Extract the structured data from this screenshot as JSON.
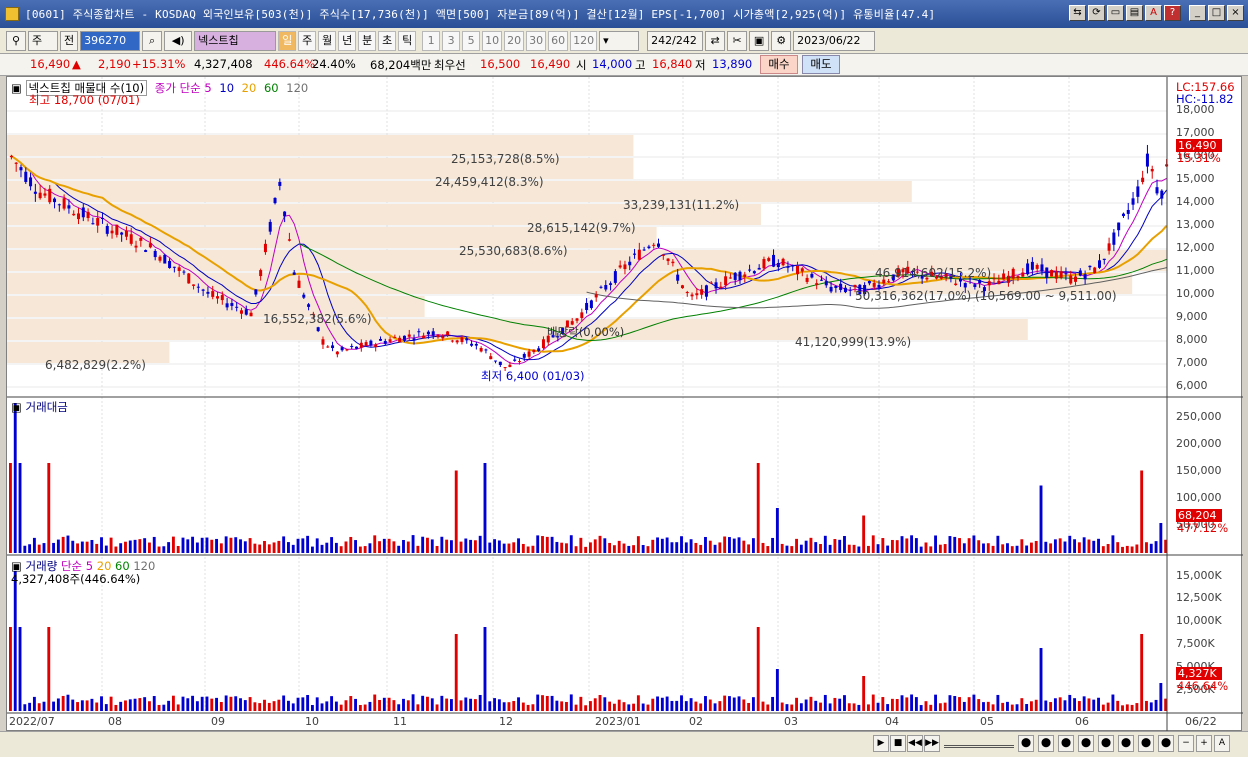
{
  "window": {
    "title": "[0601] 주식종합차트 - KOSDAQ 외국인보유[503(천)] 주식수[17,736(천)] 액면[500] 자본금[89(억)] 결산[12월] EPS[-1,700] 시가총액[2,925(억)] 유통비율[47.4]",
    "buttons": [
      "⇆",
      "⟳",
      "▭",
      "▤",
      "A",
      "?",
      "_",
      "□",
      "×"
    ]
  },
  "toolbar": {
    "mode": "주",
    "prev": "전",
    "code": "396270",
    "name": "넥스트칩",
    "periods": [
      "일",
      "주",
      "월",
      "년",
      "분",
      "초",
      "틱"
    ],
    "intervals": [
      "1",
      "3",
      "5",
      "10",
      "20",
      "30",
      "60",
      "120"
    ],
    "count": "242",
    "count_total": "/242",
    "date": "2023/06/22"
  },
  "quote": {
    "price": "16,490",
    "change_arrow": "▲",
    "change": "2,190",
    "change_pct": "+15.31%",
    "volume": "4,327,408",
    "vol_ratio": "446.64%",
    "turnover": "24.40%",
    "amount": "68,204백만",
    "priority_label": "최우선",
    "ask": "16,500",
    "bid": "16,490",
    "open_label": "시",
    "open": "14,000",
    "high_label": "고",
    "high": "16,840",
    "low_label": "저",
    "low": "13,890",
    "buy": "매수",
    "sell": "매도"
  },
  "price_panel": {
    "legend_stock": "넥스트칩 매물대 수(10)",
    "legend_ma": "종가 단순",
    "ma_periods": [
      "5",
      "10",
      "20",
      "60",
      "120"
    ],
    "high_label": "최고 18,700 (07/01)",
    "low_label": "최저 6,400 (01/03)",
    "dividend_label": "배당락(0,00%)",
    "lc": "LC:157.66",
    "hc": "HC:-11.82",
    "price_tag": "16,490",
    "pct_tag": "15.31%",
    "y_ticks": [
      "18,000",
      "17,000",
      "16,000",
      "15,000",
      "14,000",
      "13,000",
      "12,000",
      "11,000",
      "10,000",
      "9,000",
      "8,000",
      "7,000",
      "6,000"
    ],
    "volume_profile": [
      "25,153,728(8.5%)",
      "24,459,412(8.3%)",
      "33,239,131(11.2%)",
      "28,615,142(9.7%)",
      "25,530,683(8.6%)",
      "46,914,602(15.2%)",
      "50,316,362(17.0%)",
      "16,552,382(5.6%)",
      "41,120,999(13.9%)",
      "6,482,829(2.2%)"
    ],
    "annotations": [
      "(10,569.00 ~ 9,511.00)"
    ]
  },
  "amount_panel": {
    "title": "거래대금",
    "y_ticks": [
      "250,000",
      "200,000",
      "150,000",
      "100,000",
      "50,000"
    ],
    "value_tag": "68,204",
    "pct_tag": "477.12%"
  },
  "volume_panel": {
    "title": "거래량",
    "legend_ma": "단순",
    "ma_periods": [
      "5",
      "20",
      "60",
      "120"
    ],
    "current": "4,327,408주(446.64%)",
    "y_ticks": [
      "15,000K",
      "12,500K",
      "10,000K",
      "7,500K",
      "5,000K",
      "2,500K"
    ],
    "value_tag": "4,327K",
    "pct_tag": "446.64%"
  },
  "x_axis": [
    "2022/07",
    "08",
    "09",
    "10",
    "11",
    "12",
    "2023/01",
    "02",
    "03",
    "04",
    "05",
    "06",
    "06/22"
  ],
  "colors": {
    "up": "#e00000",
    "down": "#0000d0",
    "ma5": "#c000c0",
    "ma10": "#0000c0",
    "ma20": "#e8a000",
    "ma60": "#008000",
    "ma120": "#606060",
    "profile": "#f6e7d6"
  },
  "chart_data": {
    "type": "candlestick",
    "period": "daily",
    "y_range": [
      6000,
      18500
    ],
    "high": {
      "value": 18700,
      "date": "07/01"
    },
    "low": {
      "value": 6400,
      "date": "01/03"
    },
    "last_close": 16490
  }
}
